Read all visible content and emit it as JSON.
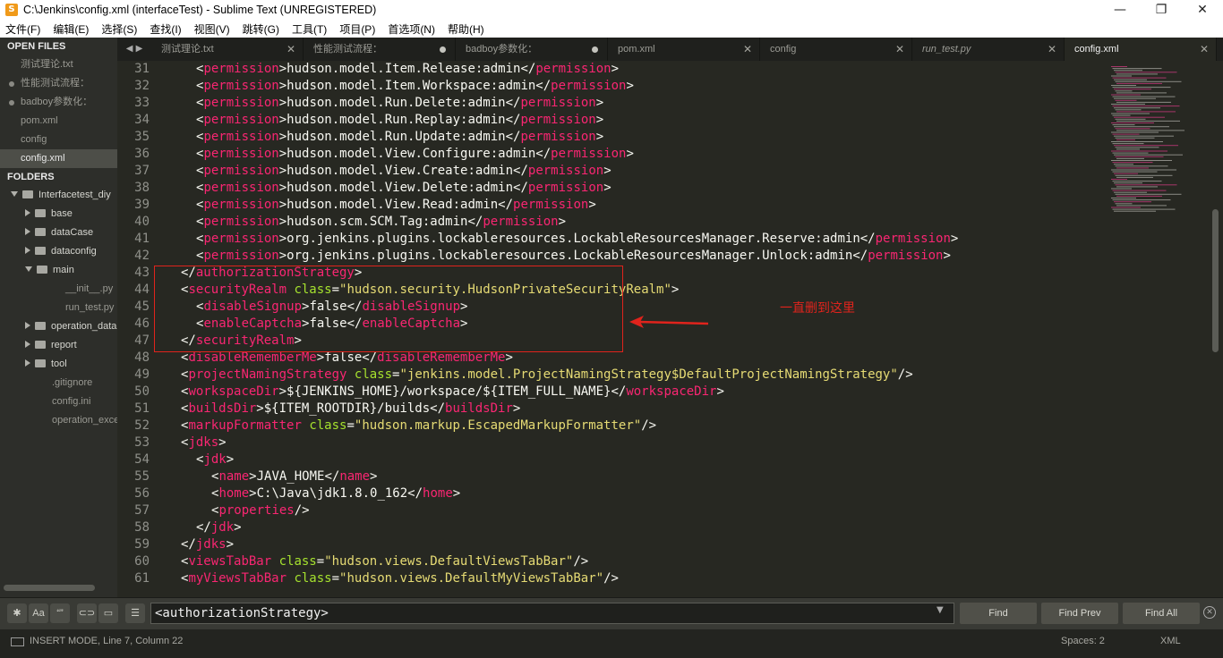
{
  "window": {
    "title": "C:\\Jenkins\\config.xml (interfaceTest) - Sublime Text (UNREGISTERED)",
    "app_icon": "S",
    "minimize": "—",
    "maximize": "❐",
    "close": "✕"
  },
  "menu": [
    "文件(F)",
    "编辑(E)",
    "选择(S)",
    "查找(I)",
    "视图(V)",
    "跳转(G)",
    "工具(T)",
    "项目(P)",
    "首选项(N)",
    "帮助(H)"
  ],
  "sidebar": {
    "open_files_header": "OPEN FILES",
    "open_files": [
      {
        "label": "测试理论.txt",
        "dirty": false,
        "active": false
      },
      {
        "label": "性能测试流程：",
        "dirty": true,
        "active": false
      },
      {
        "label": "badboy参数化：",
        "dirty": true,
        "active": false
      },
      {
        "label": "pom.xml",
        "dirty": false,
        "active": false
      },
      {
        "label": "config",
        "dirty": false,
        "active": false
      },
      {
        "label": "config.xml",
        "dirty": false,
        "active": true
      }
    ],
    "folders_header": "FOLDERS",
    "folders": [
      {
        "label": "Interfacetest_diy",
        "depth": 0,
        "kind": "folder",
        "open": true
      },
      {
        "label": "base",
        "depth": 1,
        "kind": "folder",
        "open": false
      },
      {
        "label": "dataCase",
        "depth": 1,
        "kind": "folder",
        "open": false
      },
      {
        "label": "dataconfig",
        "depth": 1,
        "kind": "folder",
        "open": false
      },
      {
        "label": "main",
        "depth": 1,
        "kind": "folder",
        "open": true
      },
      {
        "label": "__init__.py",
        "depth": 2,
        "kind": "file"
      },
      {
        "label": "run_test.py",
        "depth": 2,
        "kind": "file"
      },
      {
        "label": "operation_data",
        "depth": 1,
        "kind": "folder",
        "open": false
      },
      {
        "label": "report",
        "depth": 1,
        "kind": "folder",
        "open": false
      },
      {
        "label": "tool",
        "depth": 1,
        "kind": "folder",
        "open": false
      },
      {
        "label": ".gitignore",
        "depth": 1,
        "kind": "file"
      },
      {
        "label": "config.ini",
        "depth": 1,
        "kind": "file"
      },
      {
        "label": "operation_excel",
        "depth": 1,
        "kind": "file"
      }
    ]
  },
  "tabs_nav": {
    "prev": "◀",
    "next": "▶"
  },
  "tabs": [
    {
      "label": "测试理论.txt",
      "state": "close",
      "active": false,
      "italic": false
    },
    {
      "label": "性能测试流程：",
      "state": "dirty",
      "active": false,
      "italic": false
    },
    {
      "label": "badboy参数化：",
      "state": "dirty",
      "active": false,
      "italic": false
    },
    {
      "label": "pom.xml",
      "state": "close",
      "active": false,
      "italic": false
    },
    {
      "label": "config",
      "state": "close",
      "active": false,
      "italic": false
    },
    {
      "label": "run_test.py",
      "state": "close",
      "active": false,
      "italic": true
    },
    {
      "label": "config.xml",
      "state": "close",
      "active": true,
      "italic": false
    }
  ],
  "tab_close_glyph": "✕",
  "editor": {
    "lines": [
      {
        "n": "31",
        "indent": 2,
        "tokens": [
          [
            "t",
            "<"
          ],
          [
            "g",
            "permission"
          ],
          [
            "t",
            ">hudson.model.Item.Release:admin</"
          ],
          [
            "g",
            "permission"
          ],
          [
            "t",
            ">"
          ]
        ]
      },
      {
        "n": "32",
        "indent": 2,
        "tokens": [
          [
            "t",
            "<"
          ],
          [
            "g",
            "permission"
          ],
          [
            "t",
            ">hudson.model.Item.Workspace:admin</"
          ],
          [
            "g",
            "permission"
          ],
          [
            "t",
            ">"
          ]
        ]
      },
      {
        "n": "33",
        "indent": 2,
        "tokens": [
          [
            "t",
            "<"
          ],
          [
            "g",
            "permission"
          ],
          [
            "t",
            ">hudson.model.Run.Delete:admin</"
          ],
          [
            "g",
            "permission"
          ],
          [
            "t",
            ">"
          ]
        ]
      },
      {
        "n": "34",
        "indent": 2,
        "tokens": [
          [
            "t",
            "<"
          ],
          [
            "g",
            "permission"
          ],
          [
            "t",
            ">hudson.model.Run.Replay:admin</"
          ],
          [
            "g",
            "permission"
          ],
          [
            "t",
            ">"
          ]
        ]
      },
      {
        "n": "35",
        "indent": 2,
        "tokens": [
          [
            "t",
            "<"
          ],
          [
            "g",
            "permission"
          ],
          [
            "t",
            ">hudson.model.Run.Update:admin</"
          ],
          [
            "g",
            "permission"
          ],
          [
            "t",
            ">"
          ]
        ]
      },
      {
        "n": "36",
        "indent": 2,
        "tokens": [
          [
            "t",
            "<"
          ],
          [
            "g",
            "permission"
          ],
          [
            "t",
            ">hudson.model.View.Configure:admin</"
          ],
          [
            "g",
            "permission"
          ],
          [
            "t",
            ">"
          ]
        ]
      },
      {
        "n": "37",
        "indent": 2,
        "tokens": [
          [
            "t",
            "<"
          ],
          [
            "g",
            "permission"
          ],
          [
            "t",
            ">hudson.model.View.Create:admin</"
          ],
          [
            "g",
            "permission"
          ],
          [
            "t",
            ">"
          ]
        ]
      },
      {
        "n": "38",
        "indent": 2,
        "tokens": [
          [
            "t",
            "<"
          ],
          [
            "g",
            "permission"
          ],
          [
            "t",
            ">hudson.model.View.Delete:admin</"
          ],
          [
            "g",
            "permission"
          ],
          [
            "t",
            ">"
          ]
        ]
      },
      {
        "n": "39",
        "indent": 2,
        "tokens": [
          [
            "t",
            "<"
          ],
          [
            "g",
            "permission"
          ],
          [
            "t",
            ">hudson.model.View.Read:admin</"
          ],
          [
            "g",
            "permission"
          ],
          [
            "t",
            ">"
          ]
        ]
      },
      {
        "n": "40",
        "indent": 2,
        "tokens": [
          [
            "t",
            "<"
          ],
          [
            "g",
            "permission"
          ],
          [
            "t",
            ">hudson.scm.SCM.Tag:admin</"
          ],
          [
            "g",
            "permission"
          ],
          [
            "t",
            ">"
          ]
        ]
      },
      {
        "n": "41",
        "indent": 2,
        "tokens": [
          [
            "t",
            "<"
          ],
          [
            "g",
            "permission"
          ],
          [
            "t",
            ">org.jenkins.plugins.lockableresources.LockableResourcesManager.Reserve:admin</"
          ],
          [
            "g",
            "permission"
          ],
          [
            "t",
            ">"
          ]
        ]
      },
      {
        "n": "42",
        "indent": 2,
        "tokens": [
          [
            "t",
            "<"
          ],
          [
            "g",
            "permission"
          ],
          [
            "t",
            ">org.jenkins.plugins.lockableresources.LockableResourcesManager.Unlock:admin</"
          ],
          [
            "g",
            "permission"
          ],
          [
            "t",
            ">"
          ]
        ]
      },
      {
        "n": "43",
        "indent": 1,
        "tokens": [
          [
            "t",
            "</"
          ],
          [
            "g",
            "authorizationStrategy"
          ],
          [
            "t",
            ">"
          ]
        ]
      },
      {
        "n": "44",
        "indent": 1,
        "tokens": [
          [
            "t",
            "<"
          ],
          [
            "g",
            "securityRealm"
          ],
          [
            "t",
            " "
          ],
          [
            "a",
            "class"
          ],
          [
            "t",
            "="
          ],
          [
            "s",
            "\"hudson.security.HudsonPrivateSecurityRealm\""
          ],
          [
            "t",
            ">"
          ]
        ]
      },
      {
        "n": "45",
        "indent": 2,
        "tokens": [
          [
            "t",
            "<"
          ],
          [
            "g",
            "disableSignup"
          ],
          [
            "t",
            ">false</"
          ],
          [
            "g",
            "disableSignup"
          ],
          [
            "t",
            ">"
          ]
        ]
      },
      {
        "n": "46",
        "indent": 2,
        "tokens": [
          [
            "t",
            "<"
          ],
          [
            "g",
            "enableCaptcha"
          ],
          [
            "t",
            ">false</"
          ],
          [
            "g",
            "enableCaptcha"
          ],
          [
            "t",
            ">"
          ]
        ]
      },
      {
        "n": "47",
        "indent": 1,
        "tokens": [
          [
            "t",
            "</"
          ],
          [
            "g",
            "securityRealm"
          ],
          [
            "t",
            ">"
          ]
        ]
      },
      {
        "n": "48",
        "indent": 1,
        "tokens": [
          [
            "t",
            "<"
          ],
          [
            "g",
            "disableRememberMe"
          ],
          [
            "t",
            ">false</"
          ],
          [
            "g",
            "disableRememberMe"
          ],
          [
            "t",
            ">"
          ]
        ]
      },
      {
        "n": "49",
        "indent": 1,
        "tokens": [
          [
            "t",
            "<"
          ],
          [
            "g",
            "projectNamingStrategy"
          ],
          [
            "t",
            " "
          ],
          [
            "a",
            "class"
          ],
          [
            "t",
            "="
          ],
          [
            "s",
            "\"jenkins.model.ProjectNamingStrategy$DefaultProjectNamingStrategy\""
          ],
          [
            "t",
            "/>"
          ]
        ]
      },
      {
        "n": "50",
        "indent": 1,
        "tokens": [
          [
            "t",
            "<"
          ],
          [
            "g",
            "workspaceDir"
          ],
          [
            "t",
            ">${JENKINS_HOME}/workspace/${ITEM_FULL_NAME}</"
          ],
          [
            "g",
            "workspaceDir"
          ],
          [
            "t",
            ">"
          ]
        ]
      },
      {
        "n": "51",
        "indent": 1,
        "tokens": [
          [
            "t",
            "<"
          ],
          [
            "g",
            "buildsDir"
          ],
          [
            "t",
            ">${ITEM_ROOTDIR}/builds</"
          ],
          [
            "g",
            "buildsDir"
          ],
          [
            "t",
            ">"
          ]
        ]
      },
      {
        "n": "52",
        "indent": 1,
        "tokens": [
          [
            "t",
            "<"
          ],
          [
            "g",
            "markupFormatter"
          ],
          [
            "t",
            " "
          ],
          [
            "a",
            "class"
          ],
          [
            "t",
            "="
          ],
          [
            "s",
            "\"hudson.markup.EscapedMarkupFormatter\""
          ],
          [
            "t",
            "/>"
          ]
        ]
      },
      {
        "n": "53",
        "indent": 1,
        "tokens": [
          [
            "t",
            "<"
          ],
          [
            "g",
            "jdks"
          ],
          [
            "t",
            ">"
          ]
        ]
      },
      {
        "n": "54",
        "indent": 2,
        "tokens": [
          [
            "t",
            "<"
          ],
          [
            "g",
            "jdk"
          ],
          [
            "t",
            ">"
          ]
        ]
      },
      {
        "n": "55",
        "indent": 3,
        "tokens": [
          [
            "t",
            "<"
          ],
          [
            "g",
            "name"
          ],
          [
            "t",
            ">JAVA_HOME</"
          ],
          [
            "g",
            "name"
          ],
          [
            "t",
            ">"
          ]
        ]
      },
      {
        "n": "56",
        "indent": 3,
        "tokens": [
          [
            "t",
            "<"
          ],
          [
            "g",
            "home"
          ],
          [
            "t",
            ">C:\\Java\\jdk1.8.0_162</"
          ],
          [
            "g",
            "home"
          ],
          [
            "t",
            ">"
          ]
        ]
      },
      {
        "n": "57",
        "indent": 3,
        "tokens": [
          [
            "t",
            "<"
          ],
          [
            "g",
            "properties"
          ],
          [
            "t",
            "/>"
          ]
        ]
      },
      {
        "n": "58",
        "indent": 2,
        "tokens": [
          [
            "t",
            "</"
          ],
          [
            "g",
            "jdk"
          ],
          [
            "t",
            ">"
          ]
        ]
      },
      {
        "n": "59",
        "indent": 1,
        "tokens": [
          [
            "t",
            "</"
          ],
          [
            "g",
            "jdks"
          ],
          [
            "t",
            ">"
          ]
        ]
      },
      {
        "n": "60",
        "indent": 1,
        "tokens": [
          [
            "t",
            "<"
          ],
          [
            "g",
            "viewsTabBar"
          ],
          [
            "t",
            " "
          ],
          [
            "a",
            "class"
          ],
          [
            "t",
            "="
          ],
          [
            "s",
            "\"hudson.views.DefaultViewsTabBar\""
          ],
          [
            "t",
            "/>"
          ]
        ]
      },
      {
        "n": "61",
        "indent": 1,
        "tokens": [
          [
            "t",
            "<"
          ],
          [
            "g",
            "myViewsTabBar"
          ],
          [
            "t",
            " "
          ],
          [
            "a",
            "class"
          ],
          [
            "t",
            "="
          ],
          [
            "s",
            "\"hudson.views.DefaultMyViewsTabBar\""
          ],
          [
            "t",
            "/>"
          ]
        ]
      }
    ],
    "annotation": "一直删到这里"
  },
  "findbar": {
    "toggles": [
      "✱",
      "Aa",
      "“”",
      "⊂⊃",
      "▭",
      "☰"
    ],
    "query": "<authorizationStrategy>",
    "dropdown": "▼",
    "find": "Find",
    "find_prev": "Find Prev",
    "find_all": "Find All",
    "close": "✕"
  },
  "status": {
    "mode": "INSERT MODE, Line 7, Column 22",
    "spaces": "Spaces: 2",
    "syntax": "XML"
  },
  "colors": {
    "tag": "#f92672",
    "attr": "#a6e22e",
    "string": "#e6db74",
    "text": "#f8f8f2",
    "annotation": "#e0231c"
  }
}
